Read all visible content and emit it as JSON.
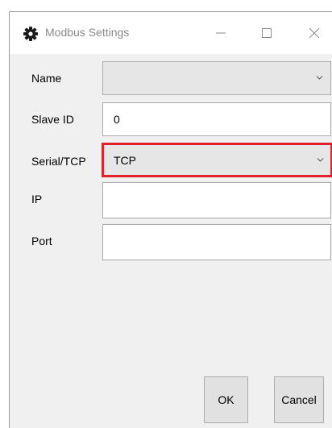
{
  "window": {
    "title": "Modbus Settings",
    "icon": "gear-icon",
    "controls": [
      "minimize-icon",
      "maximize-icon",
      "close-icon"
    ]
  },
  "form": {
    "name": {
      "label": "Name",
      "value": ""
    },
    "slave_id": {
      "label": "Slave ID",
      "value": "0"
    },
    "serial_tcp": {
      "label": "Serial/TCP",
      "value": "TCP"
    },
    "ip": {
      "label": "IP",
      "value": ""
    },
    "port": {
      "label": "Port",
      "value": ""
    }
  },
  "buttons": {
    "ok": "OK",
    "cancel": "Cancel"
  },
  "colors": {
    "highlight": "#e0202a",
    "background": "#f0f0f0"
  }
}
